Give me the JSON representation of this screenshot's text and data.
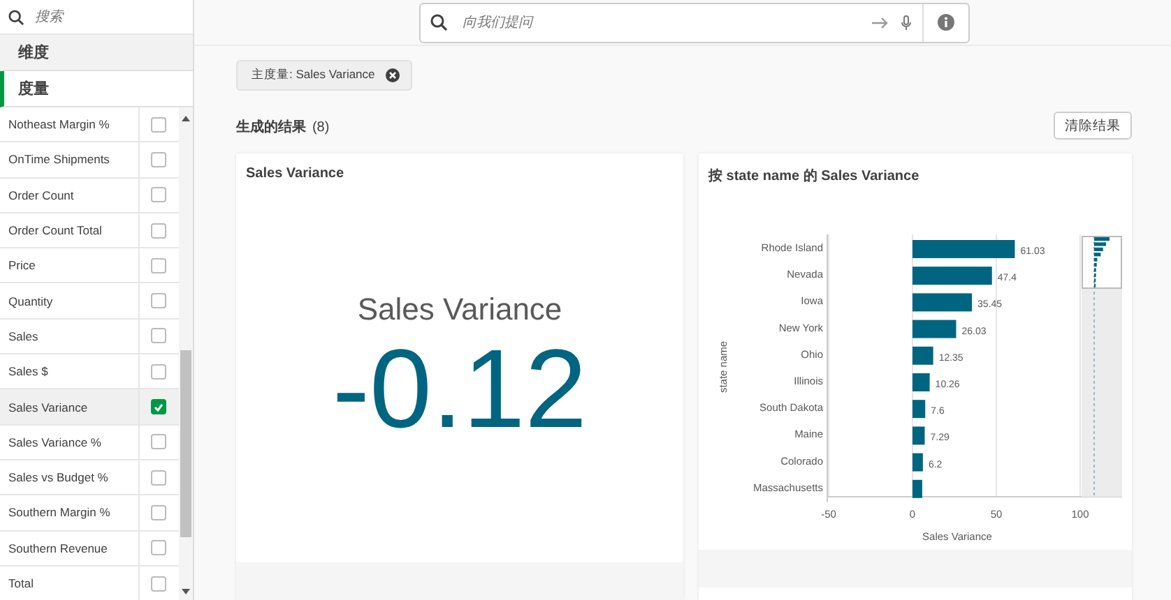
{
  "sidebar": {
    "search": {
      "placeholder": "搜索"
    },
    "sections": [
      {
        "label": "维度",
        "selected": false
      },
      {
        "label": "度量",
        "selected": true
      }
    ],
    "items": [
      {
        "label": "Notheast Margin %",
        "checked": false
      },
      {
        "label": "OnTime Shipments",
        "checked": false
      },
      {
        "label": "Order Count",
        "checked": false
      },
      {
        "label": "Order Count Total",
        "checked": false
      },
      {
        "label": "Price",
        "checked": false
      },
      {
        "label": "Quantity",
        "checked": false
      },
      {
        "label": "Sales",
        "checked": false
      },
      {
        "label": "Sales $",
        "checked": false
      },
      {
        "label": "Sales Variance",
        "checked": true
      },
      {
        "label": "Sales Variance %",
        "checked": false
      },
      {
        "label": "Sales vs Budget %",
        "checked": false
      },
      {
        "label": "Southern Margin %",
        "checked": false
      },
      {
        "label": "Southern Revenue",
        "checked": false
      },
      {
        "label": "Total",
        "checked": false
      }
    ]
  },
  "search": {
    "placeholder": "向我们提问"
  },
  "chips": [
    {
      "label": "主度量: Sales Variance"
    }
  ],
  "results": {
    "title": "生成的结果",
    "count": "(8)",
    "clear_button": "清除结果"
  },
  "cards": [
    {
      "kind": "kpi",
      "title": "Sales Variance",
      "label": "Sales Variance",
      "value": "-0.12"
    },
    {
      "kind": "chart",
      "title": "按 state name 的 Sales Variance",
      "chart_data": {
        "type": "bar",
        "orientation": "horizontal",
        "xlabel": "Sales Variance",
        "ylabel": "state name",
        "categories": [
          "Rhode Island",
          "Nevada",
          "Iowa",
          "New York",
          "Ohio",
          "Illinois",
          "South Dakota",
          "Maine",
          "Colorado",
          "Massachusetts"
        ],
        "series": [
          {
            "color": "#006580",
            "values": [
              61.03,
              47.4,
              35.45,
              26.03,
              12.35,
              10.26,
              7.6,
              7.29,
              6.2,
              5.8
            ]
          }
        ],
        "value_labels": [
          "61.03",
          "47.4",
          "35.45",
          "26.03",
          "12.35",
          "10.26",
          "7.6",
          "7.29",
          "6.2",
          null
        ],
        "grid": true,
        "xlim": [
          -50,
          125
        ],
        "xticks": [
          -50,
          0,
          50,
          100
        ]
      }
    }
  ]
}
